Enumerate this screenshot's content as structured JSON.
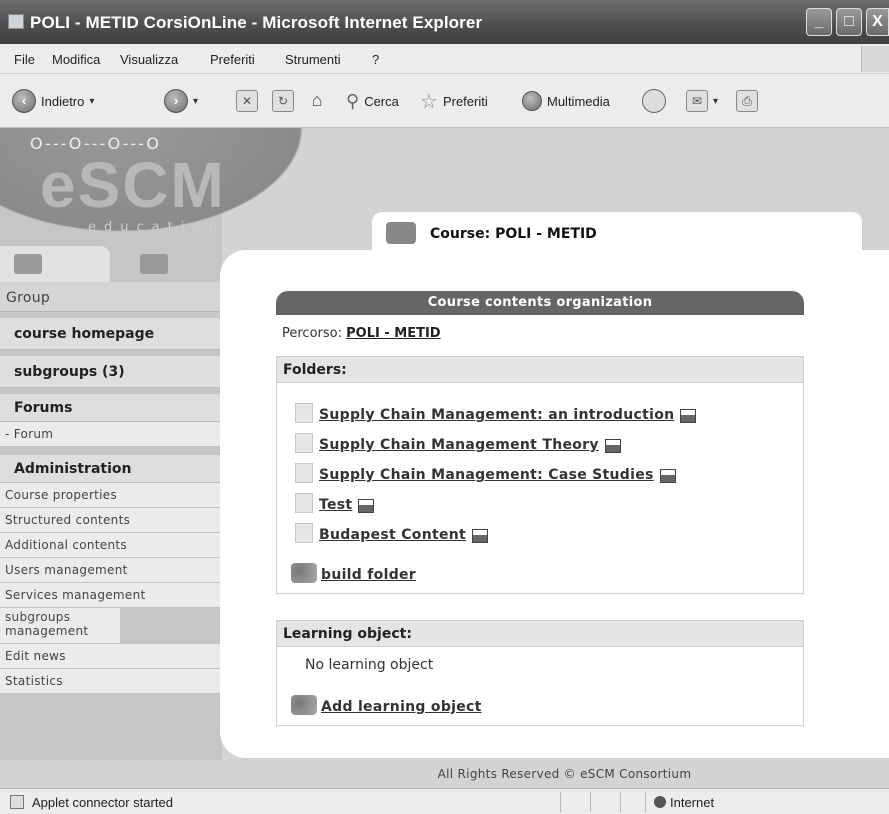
{
  "window": {
    "title": "POLI - METID CorsiOnLine - Microsoft Internet Explorer",
    "controls": [
      "_",
      "□",
      "X"
    ]
  },
  "menu": [
    "File",
    "Modifica",
    "Visualizza",
    "Preferiti",
    "Strumenti",
    "?"
  ],
  "toolbar": {
    "back": "Indietro",
    "search": "Cerca",
    "favorites": "Preferiti",
    "media": "Multimedia"
  },
  "logo": {
    "brand": "eSCM",
    "sub": "education"
  },
  "sidebar": {
    "group_label": "Group",
    "course_homepage": "course homepage",
    "subgroups": "subgroups (3)",
    "forums_head": "Forums",
    "forum_link": "- Forum",
    "admin_head": "Administration",
    "admin_links": [
      "Course properties",
      "Structured contents",
      "Additional contents",
      "Users management",
      "Services management",
      "subgroups management",
      "Edit news",
      "Statistics"
    ]
  },
  "course": {
    "tab_label": "Course: POLI - METID",
    "banner": "Course contents organization",
    "percorso_label": "Percorso:",
    "percorso_link": "POLI - METID"
  },
  "folders": {
    "header": "Folders:",
    "items": [
      "Supply Chain Management: an introduction",
      "Supply Chain Management Theory",
      "Supply Chain Management: Case Studies",
      "Test",
      "Budapest Content"
    ],
    "build": "build folder"
  },
  "learning": {
    "header": "Learning object:",
    "empty": "No learning object",
    "add": "Add learning object"
  },
  "footer": "All Rights Reserved © eSCM Consortium",
  "status": {
    "message": "Applet connector started",
    "zone": "Internet"
  }
}
